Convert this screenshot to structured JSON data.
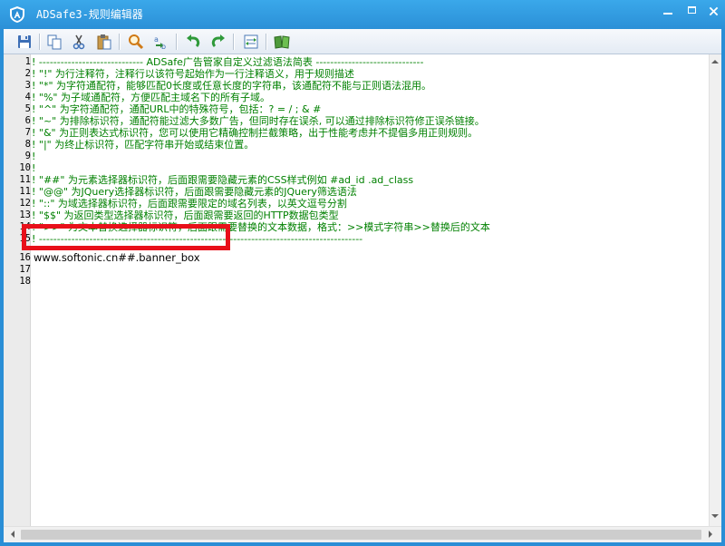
{
  "window": {
    "title": "ADSafe3-规则编辑器"
  },
  "toolbar": {
    "buttons": [
      {
        "name": "save-icon"
      },
      {
        "name": "copy-icon"
      },
      {
        "name": "cut-icon"
      },
      {
        "name": "paste-icon"
      },
      {
        "name": "find-icon"
      },
      {
        "name": "replace-icon"
      },
      {
        "name": "undo-icon"
      },
      {
        "name": "redo-icon"
      },
      {
        "name": "import-icon"
      },
      {
        "name": "help-book-icon"
      }
    ]
  },
  "editor": {
    "lines": [
      {
        "n": "1",
        "text": "! ----------------------------- ADSafe广告管家自定义过滤语法简表 ------------------------------"
      },
      {
        "n": "2",
        "text": "! \"!\" 为行注释符，注释行以该符号起始作为一行注释语义，用于规则描述"
      },
      {
        "n": "3",
        "text": "! \"*\" 为字符通配符，能够匹配0长度或任意长度的字符串，该通配符不能与正则语法混用。"
      },
      {
        "n": "4",
        "text": "! \"%\" 为子域通配符，方便匹配主域名下的所有子域。"
      },
      {
        "n": "5",
        "text": "! \"^\" 为字符通配符，通配URL中的特殊符号，包括：? = / ; & #"
      },
      {
        "n": "6",
        "text": "! \"~\" 为排除标识符，通配符能过滤大多数广告，但同时存在误杀, 可以通过排除标识符修正误杀链接。"
      },
      {
        "n": "7",
        "text": "! \"&\" 为正则表达式标识符，您可以使用它精确控制拦截策略，出于性能考虑并不提倡多用正则规则。"
      },
      {
        "n": "8",
        "text": "! \"|\" 为终止标识符，匹配字符串开始或结束位置。"
      },
      {
        "n": "9",
        "text": "!"
      },
      {
        "n": "10",
        "text": "!"
      },
      {
        "n": "11",
        "text": "! \"##\" 为元素选择器标识符，后面跟需要隐藏元素的CSS样式例如 #ad_id  .ad_class"
      },
      {
        "n": "11",
        "text": "! \"@@\" 为JQuery选择器标识符，后面跟需要隐藏元素的JQuery筛选语法"
      },
      {
        "n": "12",
        "text": "! \"::\" 为域选择器标识符，后面跟需要限定的域名列表，以英文逗号分割"
      },
      {
        "n": "13",
        "text": "! \"$$\" 为返回类型选择器标识符，后面跟需要返回的HTTP数据包类型"
      },
      {
        "n": "14",
        "text": "! \">>\" 为文本替换选择器标识符，后面跟需要替换的文本数据，格式：>>模式字符串>>替换后的文本"
      },
      {
        "n": "15",
        "text": "! ------------------------------------------------------------------------------------------"
      },
      {
        "n": "16",
        "text": "www.softonic.cn##.banner_box",
        "rule": true
      },
      {
        "n": "17",
        "text": ""
      },
      {
        "n": "18",
        "text": ""
      }
    ]
  },
  "colors": {
    "titlebar": "#2a8ed6",
    "comment": "#008000",
    "highlight": "#e8101a"
  }
}
